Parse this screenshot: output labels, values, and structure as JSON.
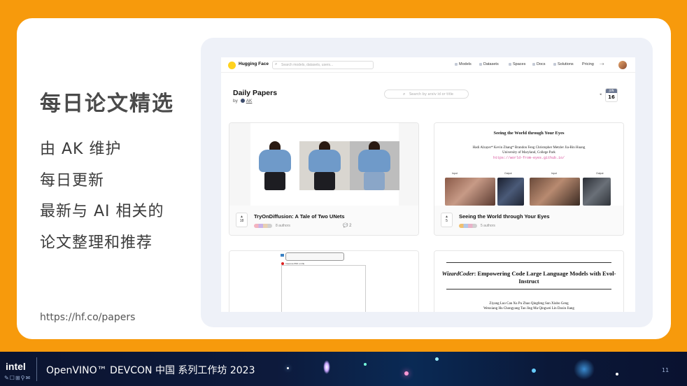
{
  "slide": {
    "title": "每日论文精选",
    "bullets": [
      "由 AK 维护",
      "每日更新",
      "最新与 AI 相关的",
      "论文整理和推荐"
    ],
    "link": "https://hf.co/papers"
  },
  "hf": {
    "brand": "Hugging Face",
    "search_placeholder": "Search models, datasets, users...",
    "menu": [
      "Models",
      "Datasets",
      "Spaces",
      "Docs",
      "Solutions",
      "Pricing"
    ],
    "page_title": "Daily Papers",
    "by": "by",
    "author": "AK",
    "paper_search_placeholder": "Search by arxiv id or title",
    "date_month": "JUN",
    "date_day": "16",
    "papers": [
      {
        "title": "TryOnDiffusion: A Tale of Two UNets",
        "votes": "18",
        "authors": "8 authors",
        "comments": "2"
      },
      {
        "title": "Seeing the World through Your Eyes",
        "votes": "5",
        "authors": "5 authors"
      }
    ],
    "paper2_thumb": {
      "title": "Seeing the World through Your Eyes",
      "authors_line1": "Hadi Alzayer*   Kevin Zhang*   Brandon Feng   Christopher Metzler   Jia-Bin Huang",
      "authors_line2": "University of Maryland, College Park",
      "url": "https://world-from-eyes.github.io/",
      "labels": [
        "Input",
        "Output",
        "Input",
        "Output"
      ]
    },
    "paper3_thumb": {
      "text": "Insecure PDF on file"
    },
    "paper4_thumb": {
      "title_italic": "WizardCoder",
      "title_rest": ": Empowering Code Large Language Models with Evol-Instruct",
      "authors_line1": "Ziyang Luo   Can Xu   Pu Zhao   Qingfeng Sun   Xiubo Geng",
      "authors_line2": "Wenxiang Hu   Chongyang Tao   Jing Ma   Qingwei Lin   Daxin Jiang"
    }
  },
  "footer": {
    "logo": "intel",
    "text": "OpenVINO™ DEVCON  中国  系列工作坊 2023",
    "page": "11"
  },
  "colors": {
    "background": "#f79a0c",
    "footer": "#0d1a3c",
    "link": "#d84e9a"
  }
}
